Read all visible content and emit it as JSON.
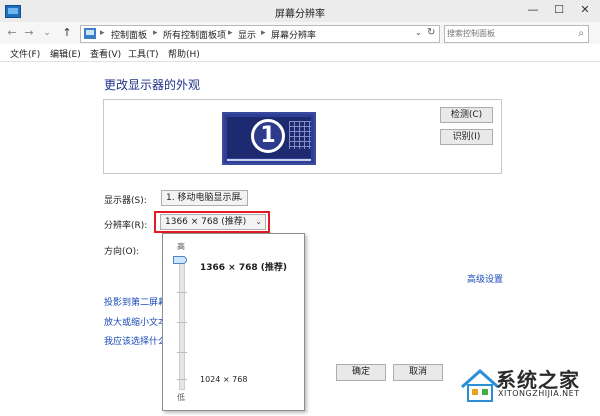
{
  "window": {
    "title": "屏幕分辨率",
    "minimize_label": "—",
    "maximize_label": "☐",
    "close_label": "✕"
  },
  "address_bar": {
    "back_icon": "←",
    "forward_icon": "→",
    "history_icon": "⌄",
    "up_icon": "↑",
    "breadcrumbs": [
      "控制面板",
      "所有控制面板项",
      "显示",
      "屏幕分辨率"
    ],
    "separator": "▸",
    "dropdown_icon": "⌄",
    "refresh_icon": "↻",
    "search_placeholder": "搜索控制面板",
    "search_icon": "⌕"
  },
  "menu": {
    "items": [
      "文件(F)",
      "编辑(E)",
      "查看(V)",
      "工具(T)",
      "帮助(H)"
    ]
  },
  "main": {
    "heading": "更改显示器的外观",
    "monitor_number": "1",
    "detect_button": "检测(C)",
    "identify_button": "识别(I)",
    "display_label": "显示器(S):",
    "display_value": "1. 移动电脑显示屏",
    "resolution_label": "分辨率(R):",
    "resolution_value": "1366 × 768 (推荐)",
    "orientation_label": "方向(O):",
    "advanced_link": "高级设置",
    "links": [
      "投影到第二屏幕",
      "放大或缩小文本",
      "我应该选择什么"
    ],
    "ok_button": "确定",
    "cancel_button": "取消"
  },
  "resolution_popup": {
    "high_label": "高",
    "low_label": "低",
    "top_resolution": "1366 × 768 (推荐)",
    "bottom_resolution": "1024 × 768",
    "slider_level_fraction": 1.0
  },
  "watermark": {
    "text": "系统之家",
    "url": "XITONGZHIJIA.NET"
  },
  "colors": {
    "heading": "#1e3287",
    "link": "#1a4bb8",
    "highlight_border": "#e01b24",
    "monitor": "#2f3f96"
  }
}
